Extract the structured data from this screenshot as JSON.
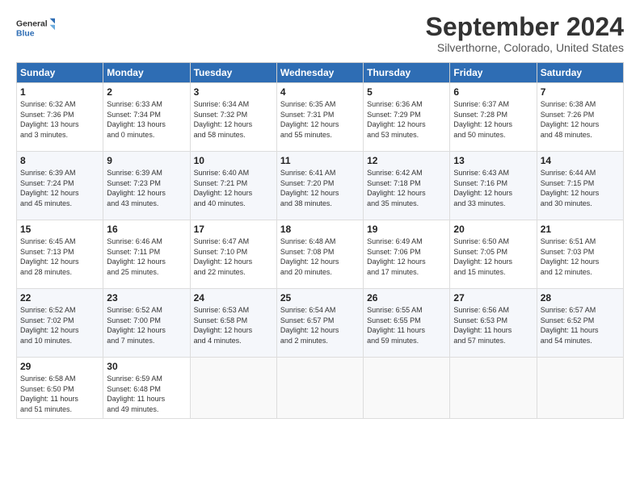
{
  "logo": {
    "line1": "General",
    "line2": "Blue"
  },
  "title": "September 2024",
  "subtitle": "Silverthorne, Colorado, United States",
  "weekdays": [
    "Sunday",
    "Monday",
    "Tuesday",
    "Wednesday",
    "Thursday",
    "Friday",
    "Saturday"
  ],
  "weeks": [
    [
      {
        "day": "1",
        "info": "Sunrise: 6:32 AM\nSunset: 7:36 PM\nDaylight: 13 hours\nand 3 minutes."
      },
      {
        "day": "2",
        "info": "Sunrise: 6:33 AM\nSunset: 7:34 PM\nDaylight: 13 hours\nand 0 minutes."
      },
      {
        "day": "3",
        "info": "Sunrise: 6:34 AM\nSunset: 7:32 PM\nDaylight: 12 hours\nand 58 minutes."
      },
      {
        "day": "4",
        "info": "Sunrise: 6:35 AM\nSunset: 7:31 PM\nDaylight: 12 hours\nand 55 minutes."
      },
      {
        "day": "5",
        "info": "Sunrise: 6:36 AM\nSunset: 7:29 PM\nDaylight: 12 hours\nand 53 minutes."
      },
      {
        "day": "6",
        "info": "Sunrise: 6:37 AM\nSunset: 7:28 PM\nDaylight: 12 hours\nand 50 minutes."
      },
      {
        "day": "7",
        "info": "Sunrise: 6:38 AM\nSunset: 7:26 PM\nDaylight: 12 hours\nand 48 minutes."
      }
    ],
    [
      {
        "day": "8",
        "info": "Sunrise: 6:39 AM\nSunset: 7:24 PM\nDaylight: 12 hours\nand 45 minutes."
      },
      {
        "day": "9",
        "info": "Sunrise: 6:39 AM\nSunset: 7:23 PM\nDaylight: 12 hours\nand 43 minutes."
      },
      {
        "day": "10",
        "info": "Sunrise: 6:40 AM\nSunset: 7:21 PM\nDaylight: 12 hours\nand 40 minutes."
      },
      {
        "day": "11",
        "info": "Sunrise: 6:41 AM\nSunset: 7:20 PM\nDaylight: 12 hours\nand 38 minutes."
      },
      {
        "day": "12",
        "info": "Sunrise: 6:42 AM\nSunset: 7:18 PM\nDaylight: 12 hours\nand 35 minutes."
      },
      {
        "day": "13",
        "info": "Sunrise: 6:43 AM\nSunset: 7:16 PM\nDaylight: 12 hours\nand 33 minutes."
      },
      {
        "day": "14",
        "info": "Sunrise: 6:44 AM\nSunset: 7:15 PM\nDaylight: 12 hours\nand 30 minutes."
      }
    ],
    [
      {
        "day": "15",
        "info": "Sunrise: 6:45 AM\nSunset: 7:13 PM\nDaylight: 12 hours\nand 28 minutes."
      },
      {
        "day": "16",
        "info": "Sunrise: 6:46 AM\nSunset: 7:11 PM\nDaylight: 12 hours\nand 25 minutes."
      },
      {
        "day": "17",
        "info": "Sunrise: 6:47 AM\nSunset: 7:10 PM\nDaylight: 12 hours\nand 22 minutes."
      },
      {
        "day": "18",
        "info": "Sunrise: 6:48 AM\nSunset: 7:08 PM\nDaylight: 12 hours\nand 20 minutes."
      },
      {
        "day": "19",
        "info": "Sunrise: 6:49 AM\nSunset: 7:06 PM\nDaylight: 12 hours\nand 17 minutes."
      },
      {
        "day": "20",
        "info": "Sunrise: 6:50 AM\nSunset: 7:05 PM\nDaylight: 12 hours\nand 15 minutes."
      },
      {
        "day": "21",
        "info": "Sunrise: 6:51 AM\nSunset: 7:03 PM\nDaylight: 12 hours\nand 12 minutes."
      }
    ],
    [
      {
        "day": "22",
        "info": "Sunrise: 6:52 AM\nSunset: 7:02 PM\nDaylight: 12 hours\nand 10 minutes."
      },
      {
        "day": "23",
        "info": "Sunrise: 6:52 AM\nSunset: 7:00 PM\nDaylight: 12 hours\nand 7 minutes."
      },
      {
        "day": "24",
        "info": "Sunrise: 6:53 AM\nSunset: 6:58 PM\nDaylight: 12 hours\nand 4 minutes."
      },
      {
        "day": "25",
        "info": "Sunrise: 6:54 AM\nSunset: 6:57 PM\nDaylight: 12 hours\nand 2 minutes."
      },
      {
        "day": "26",
        "info": "Sunrise: 6:55 AM\nSunset: 6:55 PM\nDaylight: 11 hours\nand 59 minutes."
      },
      {
        "day": "27",
        "info": "Sunrise: 6:56 AM\nSunset: 6:53 PM\nDaylight: 11 hours\nand 57 minutes."
      },
      {
        "day": "28",
        "info": "Sunrise: 6:57 AM\nSunset: 6:52 PM\nDaylight: 11 hours\nand 54 minutes."
      }
    ],
    [
      {
        "day": "29",
        "info": "Sunrise: 6:58 AM\nSunset: 6:50 PM\nDaylight: 11 hours\nand 51 minutes."
      },
      {
        "day": "30",
        "info": "Sunrise: 6:59 AM\nSunset: 6:48 PM\nDaylight: 11 hours\nand 49 minutes."
      },
      {
        "day": "",
        "info": ""
      },
      {
        "day": "",
        "info": ""
      },
      {
        "day": "",
        "info": ""
      },
      {
        "day": "",
        "info": ""
      },
      {
        "day": "",
        "info": ""
      }
    ]
  ]
}
